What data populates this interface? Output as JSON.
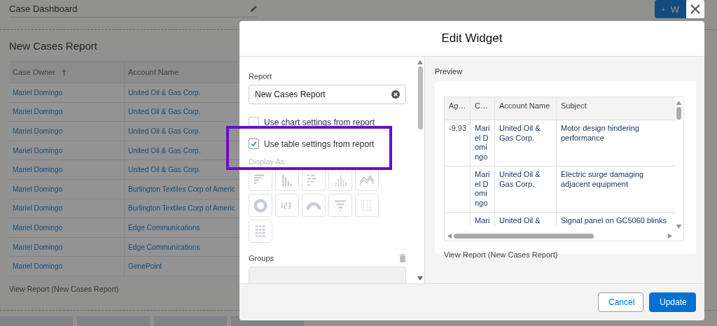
{
  "dashboard": {
    "title": "Case Dashboard",
    "add_button": {
      "label": "W"
    },
    "widget": {
      "title": "New Cases Report",
      "columns": [
        {
          "label": "Case Owner",
          "sorted": true
        },
        {
          "label": "Account Name",
          "sorted": false
        }
      ],
      "rows": [
        [
          "Mariel Domingo",
          "United Oil & Gas Corp."
        ],
        [
          "Mariel Domingo",
          "United Oil & Gas Corp."
        ],
        [
          "Mariel Domingo",
          "United Oil & Gas Corp."
        ],
        [
          "Mariel Domingo",
          "United Oil & Gas Corp."
        ],
        [
          "Mariel Domingo",
          "United Oil & Gas Corp."
        ],
        [
          "Mariel Domingo",
          "Burlington Textiles Corp of Americ"
        ],
        [
          "Mariel Domingo",
          "Burlington Textiles Corp of Americ"
        ],
        [
          "Mariel Domingo",
          "Edge Communications"
        ],
        [
          "Mariel Domingo",
          "Edge Communications"
        ],
        [
          "Mariel Domingo",
          "GenePoint"
        ]
      ],
      "footer_link": "View Report (New Cases Report)"
    }
  },
  "modal": {
    "title": "Edit Widget",
    "report": {
      "label": "Report",
      "value": "New Cases Report"
    },
    "checkboxes": [
      {
        "label": "Use chart settings from report",
        "checked": false
      },
      {
        "label": "Use table settings from report",
        "checked": true
      }
    ],
    "display_as": {
      "label": "Display As",
      "disabled": true
    },
    "groups": {
      "label": "Groups"
    },
    "preview": {
      "title": "Preview",
      "columns": [
        "Ag…",
        "C…",
        "Account Name",
        "Subject"
      ],
      "rows": [
        {
          "age": "-9,93",
          "owner": "Mariel Domingo",
          "account": "United Oil & Gas Corp.",
          "subject": "Motor design hindering performance"
        },
        {
          "owner": "Mariel Domingo",
          "account": "United Oil & Gas Corp.",
          "subject": "Electric surge damaging adjacent equipment"
        },
        {
          "owner": "Mari",
          "account": "United Oil &",
          "subject": "Signal panel on GC5060 blinks"
        }
      ],
      "link": "View Report (New Cases Report)"
    },
    "buttons": [
      {
        "label": "Cancel",
        "kind": "neutral"
      },
      {
        "label": "Update",
        "kind": "brand"
      }
    ]
  }
}
